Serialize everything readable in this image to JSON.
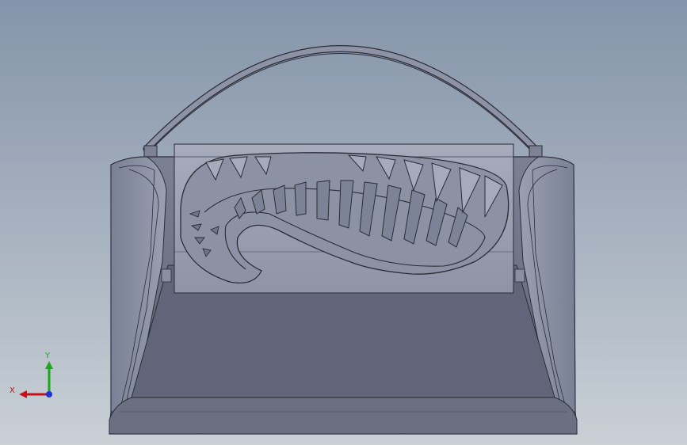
{
  "viewport": {
    "background_top": "#8594aa",
    "background_bottom": "#c9d0d6"
  },
  "model": {
    "body_color": "#6e7385",
    "edge_color": "#2a2c36",
    "panel_color": "#9ba1b0"
  },
  "triad": {
    "x_label": "X",
    "y_label": "Y",
    "x_color": "#c8101b",
    "y_color": "#1ea51e",
    "z_color": "#1d2fd6"
  }
}
